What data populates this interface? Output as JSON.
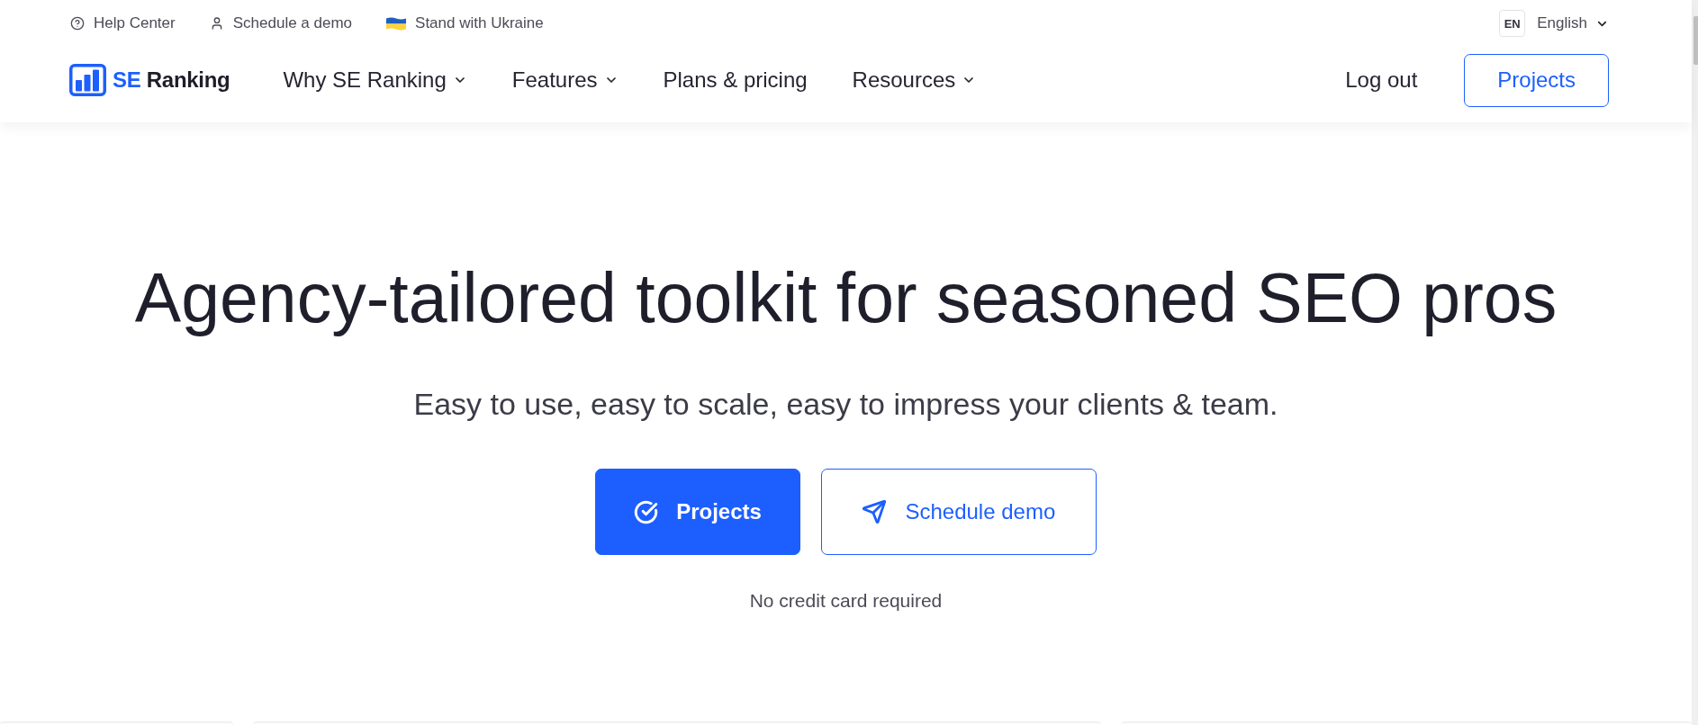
{
  "top_bar": {
    "links": [
      {
        "kind": "help",
        "label": "Help Center"
      },
      {
        "kind": "demo",
        "label": "Schedule a demo"
      },
      {
        "kind": "ukraine",
        "label": "Stand with Ukraine"
      }
    ],
    "language": {
      "code": "EN",
      "label": "English"
    }
  },
  "header": {
    "logo": {
      "accent": "SE",
      "name": "Ranking"
    },
    "nav": [
      {
        "label": "Why SE Ranking",
        "dropdown": true
      },
      {
        "label": "Features",
        "dropdown": true
      },
      {
        "label": "Plans & pricing",
        "dropdown": false
      },
      {
        "label": "Resources",
        "dropdown": true
      }
    ],
    "login": "Log out",
    "cta": "Projects"
  },
  "hero": {
    "title": "Agency-tailored toolkit for seasoned SEO pros",
    "subtitle": "Easy to use, easy to scale, easy to impress your clients & team.",
    "buttons": [
      {
        "kind": "primary",
        "label": "Projects"
      },
      {
        "kind": "secondary",
        "label": "Schedule demo"
      }
    ],
    "note": "No credit card required"
  }
}
